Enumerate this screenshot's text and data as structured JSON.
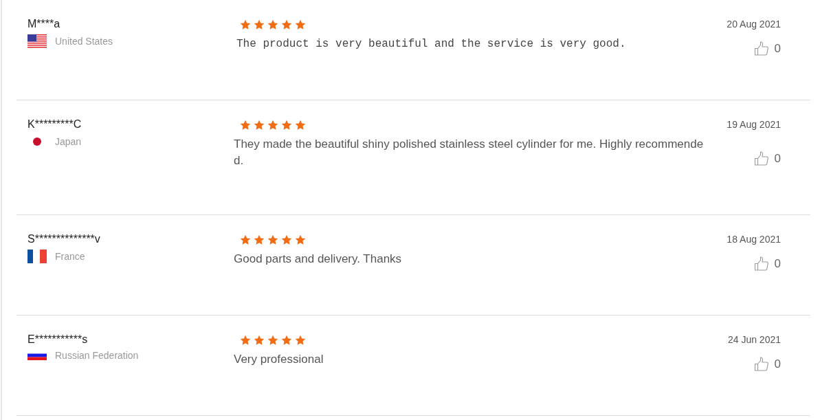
{
  "reviews": [
    {
      "name": "M****a",
      "country": "United States",
      "flag": {
        "kind": "us"
      },
      "stars": 5,
      "text": "The product is very beautiful and the service is very good.",
      "monospace": true,
      "date": "20 Aug 2021",
      "likes": "0"
    },
    {
      "name": "K*********C",
      "country": "Japan",
      "flag": {
        "kind": "jp"
      },
      "stars": 5,
      "text": "They made the beautiful shiny polished stainless steel cylinder for me. Highly recommended.",
      "monospace": false,
      "date": "19 Aug 2021",
      "likes": "0"
    },
    {
      "name": "S**************v",
      "country": "France",
      "flag": {
        "kind": "fr"
      },
      "stars": 5,
      "text": "Good parts and delivery. Thanks",
      "monospace": false,
      "date": "18 Aug 2021",
      "likes": "0"
    },
    {
      "name": "E***********s",
      "country": "Russian Federation",
      "flag": {
        "kind": "ru"
      },
      "stars": 5,
      "text": "Very professional",
      "monospace": false,
      "date": "24 Jun 2021",
      "likes": "0"
    }
  ]
}
